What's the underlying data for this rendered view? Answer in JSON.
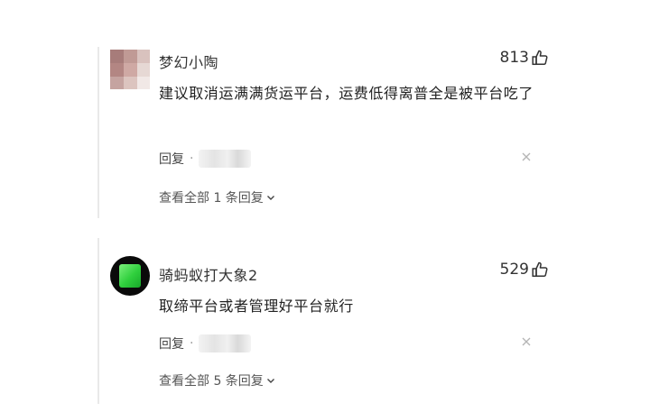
{
  "comments": [
    {
      "author": "梦幻小陶",
      "likes": "813",
      "body": "建议取消运满满货运平台，运费低得离普全是被平台吃了",
      "reply_label": "回复",
      "dot": "·",
      "view_replies": "查看全部 1 条回复"
    },
    {
      "author": "骑蚂蚁打大象2",
      "likes": "529",
      "body": "取缔平台或者管理好平台就行",
      "reply_label": "回复",
      "dot": "·",
      "view_replies": "查看全部 5 条回复"
    }
  ],
  "icons": {
    "like": "thumbs-up-icon",
    "close": "close-icon",
    "expand": "chevron-down-icon"
  },
  "colors": {
    "text": "#222222",
    "muted": "#555555",
    "avatar2_bg": "#0a0a0a",
    "avatar2_fg": "#2fcf3d"
  }
}
